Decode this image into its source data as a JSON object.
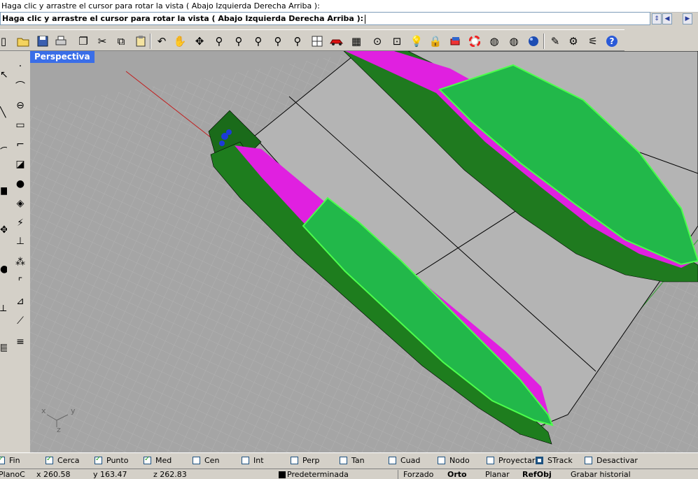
{
  "command": {
    "history_line": "Haga clic y arrastre el cursor para rotar la vista ( Abajo  Izquierda  Derecha  Arriba ):",
    "prompt_line": "Haga clic y arrastre el cursor para rotar la vista ( Abajo  Izquierda  Derecha  Arriba ):"
  },
  "toolbar": {
    "icons": [
      "new-icon",
      "open-icon",
      "save-icon",
      "print-icon",
      "import-icon",
      "cut-icon",
      "copy-icon",
      "paste-icon",
      "undo-icon",
      "pan-icon",
      "rotate-icon",
      "zoom-icon",
      "zoom-window-icon",
      "zoom-extents-icon",
      "zoom-selected-icon",
      "zoom-dynamic-icon",
      "viewports-icon",
      "car-icon",
      "grid-icon",
      "cplane-icon",
      "elevator-icon",
      "light-icon",
      "lock-icon",
      "layer-icon",
      "color-wheel-icon",
      "wireframe-sphere-icon",
      "shaded-sphere-icon",
      "rendered-sphere-icon",
      "pen-icon",
      "settings-icon",
      "options-icon",
      "help-icon"
    ]
  },
  "viewport": {
    "title": "Perspectiva",
    "axis_labels": {
      "x": "x",
      "y": "y",
      "z": "z"
    }
  },
  "osnaps": [
    {
      "label": "Fin",
      "checked": true
    },
    {
      "label": "Cerca",
      "checked": true
    },
    {
      "label": "Punto",
      "checked": true
    },
    {
      "label": "Med",
      "checked": true
    },
    {
      "label": "Cen",
      "checked": false
    },
    {
      "label": "Int",
      "checked": false
    },
    {
      "label": "Perp",
      "checked": false
    },
    {
      "label": "Tan",
      "checked": false
    },
    {
      "label": "Cuad",
      "checked": false
    },
    {
      "label": "Nodo",
      "checked": false
    },
    {
      "label": "Proyectar",
      "checked": false
    },
    {
      "label": "STrack",
      "checked": true
    },
    {
      "label": "Desactivar",
      "checked": false
    }
  ],
  "status": {
    "cplane": "PlanoC",
    "x": "x 260.58",
    "y": "y 163.47",
    "z": "z 262.83",
    "layer": "Predeterminada",
    "snap": "Forzado",
    "ortho": "Orto",
    "planar": "Planar",
    "osnap": "RefObj",
    "history": "Grabar historial"
  },
  "colors": {
    "viewport_bg": "#a5a5a5",
    "title_bg": "#3a6ee8",
    "hull_green": "#22b84a",
    "hull_magenta": "#e020e0",
    "deck_gray": "#b4b4b4"
  }
}
